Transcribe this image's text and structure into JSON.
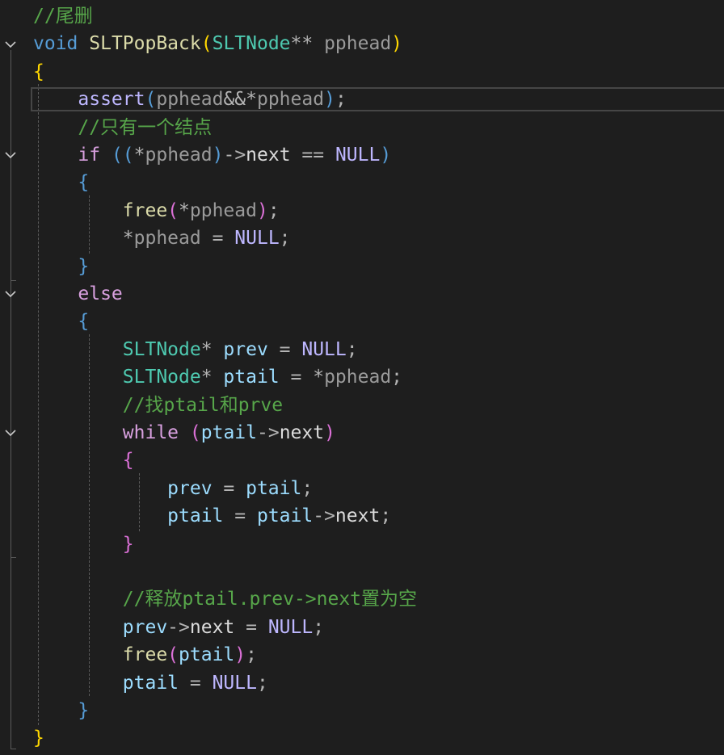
{
  "editor": {
    "language": "C",
    "theme": "dark",
    "colors": {
      "background": "#1e1e1e",
      "comment": "#57a64a",
      "keyword": "#569cd6",
      "control": "#d8a0df",
      "function": "#dcdcaa",
      "type": "#4ec9b0",
      "parameter": "#9a9a9a",
      "variable": "#9cdcfe",
      "macro": "#beb7ff",
      "plain": "#dcdcdc"
    },
    "current_line": 4,
    "fold_markers": [
      {
        "line": 2,
        "icon": "chevron-down-icon"
      },
      {
        "line": 6,
        "icon": "chevron-down-icon"
      },
      {
        "line": 11,
        "icon": "chevron-down-icon"
      },
      {
        "line": 16,
        "icon": "chevron-down-icon"
      }
    ],
    "lines": [
      [
        {
          "t": "//尾删",
          "c": "comment"
        }
      ],
      [
        {
          "t": "void",
          "c": "kw"
        },
        {
          "t": " ",
          "c": "plain"
        },
        {
          "t": "SLTPopBack",
          "c": "fn"
        },
        {
          "t": "(",
          "c": "paren"
        },
        {
          "t": "SLTNode",
          "c": "type"
        },
        {
          "t": "**",
          "c": "op"
        },
        {
          "t": " pphead",
          "c": "param"
        },
        {
          "t": ")",
          "c": "paren"
        }
      ],
      [
        {
          "t": "{",
          "c": "brace1"
        }
      ],
      [
        {
          "t": "    ",
          "c": "plain"
        },
        {
          "t": "assert",
          "c": "macro"
        },
        {
          "t": "(",
          "c": "paren2"
        },
        {
          "t": "pphead",
          "c": "param"
        },
        {
          "t": "&&*",
          "c": "op"
        },
        {
          "t": "pphead",
          "c": "param"
        },
        {
          "t": ")",
          "c": "paren2"
        },
        {
          "t": ";",
          "c": "op"
        }
      ],
      [
        {
          "t": "    ",
          "c": "plain"
        },
        {
          "t": "//只有一个结点",
          "c": "comment"
        }
      ],
      [
        {
          "t": "    ",
          "c": "plain"
        },
        {
          "t": "if",
          "c": "ctrl"
        },
        {
          "t": " ",
          "c": "plain"
        },
        {
          "t": "((",
          "c": "paren2"
        },
        {
          "t": "*",
          "c": "op"
        },
        {
          "t": "pphead",
          "c": "param"
        },
        {
          "t": ")",
          "c": "paren2"
        },
        {
          "t": "->",
          "c": "op"
        },
        {
          "t": "next",
          "c": "plain"
        },
        {
          "t": " == ",
          "c": "op"
        },
        {
          "t": "NULL",
          "c": "macro"
        },
        {
          "t": ")",
          "c": "paren2"
        }
      ],
      [
        {
          "t": "    ",
          "c": "plain"
        },
        {
          "t": "{",
          "c": "brace2"
        }
      ],
      [
        {
          "t": "        ",
          "c": "plain"
        },
        {
          "t": "free",
          "c": "fn"
        },
        {
          "t": "(",
          "c": "paren3"
        },
        {
          "t": "*",
          "c": "op"
        },
        {
          "t": "pphead",
          "c": "param"
        },
        {
          "t": ")",
          "c": "paren3"
        },
        {
          "t": ";",
          "c": "op"
        }
      ],
      [
        {
          "t": "        ",
          "c": "plain"
        },
        {
          "t": "*",
          "c": "op"
        },
        {
          "t": "pphead",
          "c": "param"
        },
        {
          "t": " = ",
          "c": "op"
        },
        {
          "t": "NULL",
          "c": "macro"
        },
        {
          "t": ";",
          "c": "op"
        }
      ],
      [
        {
          "t": "    ",
          "c": "plain"
        },
        {
          "t": "}",
          "c": "brace2"
        }
      ],
      [
        {
          "t": "    ",
          "c": "plain"
        },
        {
          "t": "else",
          "c": "ctrl"
        }
      ],
      [
        {
          "t": "    ",
          "c": "plain"
        },
        {
          "t": "{",
          "c": "brace2"
        }
      ],
      [
        {
          "t": "        ",
          "c": "plain"
        },
        {
          "t": "SLTNode",
          "c": "type"
        },
        {
          "t": "* ",
          "c": "op"
        },
        {
          "t": "prev",
          "c": "var"
        },
        {
          "t": " = ",
          "c": "op"
        },
        {
          "t": "NULL",
          "c": "macro"
        },
        {
          "t": ";",
          "c": "op"
        }
      ],
      [
        {
          "t": "        ",
          "c": "plain"
        },
        {
          "t": "SLTNode",
          "c": "type"
        },
        {
          "t": "* ",
          "c": "op"
        },
        {
          "t": "ptail",
          "c": "var"
        },
        {
          "t": " = ",
          "c": "op"
        },
        {
          "t": "*",
          "c": "op"
        },
        {
          "t": "pphead",
          "c": "param"
        },
        {
          "t": ";",
          "c": "op"
        }
      ],
      [
        {
          "t": "        ",
          "c": "plain"
        },
        {
          "t": "//找ptail和prve",
          "c": "comment"
        }
      ],
      [
        {
          "t": "        ",
          "c": "plain"
        },
        {
          "t": "while",
          "c": "ctrl"
        },
        {
          "t": " ",
          "c": "plain"
        },
        {
          "t": "(",
          "c": "paren3"
        },
        {
          "t": "ptail",
          "c": "var"
        },
        {
          "t": "->",
          "c": "op"
        },
        {
          "t": "next",
          "c": "plain"
        },
        {
          "t": ")",
          "c": "paren3"
        }
      ],
      [
        {
          "t": "        ",
          "c": "plain"
        },
        {
          "t": "{",
          "c": "brace3"
        }
      ],
      [
        {
          "t": "            ",
          "c": "plain"
        },
        {
          "t": "prev",
          "c": "var"
        },
        {
          "t": " = ",
          "c": "op"
        },
        {
          "t": "ptail",
          "c": "var"
        },
        {
          "t": ";",
          "c": "op"
        }
      ],
      [
        {
          "t": "            ",
          "c": "plain"
        },
        {
          "t": "ptail",
          "c": "var"
        },
        {
          "t": " = ",
          "c": "op"
        },
        {
          "t": "ptail",
          "c": "var"
        },
        {
          "t": "->",
          "c": "op"
        },
        {
          "t": "next",
          "c": "plain"
        },
        {
          "t": ";",
          "c": "op"
        }
      ],
      [
        {
          "t": "        ",
          "c": "plain"
        },
        {
          "t": "}",
          "c": "brace3"
        }
      ],
      [
        {
          "t": "",
          "c": "plain"
        }
      ],
      [
        {
          "t": "        ",
          "c": "plain"
        },
        {
          "t": "//释放ptail.prev->next置为空",
          "c": "comment"
        }
      ],
      [
        {
          "t": "        ",
          "c": "plain"
        },
        {
          "t": "prev",
          "c": "var"
        },
        {
          "t": "->",
          "c": "op"
        },
        {
          "t": "next",
          "c": "plain"
        },
        {
          "t": " = ",
          "c": "op"
        },
        {
          "t": "NULL",
          "c": "macro"
        },
        {
          "t": ";",
          "c": "op"
        }
      ],
      [
        {
          "t": "        ",
          "c": "plain"
        },
        {
          "t": "free",
          "c": "fn"
        },
        {
          "t": "(",
          "c": "paren3"
        },
        {
          "t": "ptail",
          "c": "var"
        },
        {
          "t": ")",
          "c": "paren3"
        },
        {
          "t": ";",
          "c": "op"
        }
      ],
      [
        {
          "t": "        ",
          "c": "plain"
        },
        {
          "t": "ptail",
          "c": "var"
        },
        {
          "t": " = ",
          "c": "op"
        },
        {
          "t": "NULL",
          "c": "macro"
        },
        {
          "t": ";",
          "c": "op"
        }
      ],
      [
        {
          "t": "    ",
          "c": "plain"
        },
        {
          "t": "}",
          "c": "brace2"
        }
      ],
      [
        {
          "t": "}",
          "c": "brace1"
        }
      ]
    ]
  }
}
